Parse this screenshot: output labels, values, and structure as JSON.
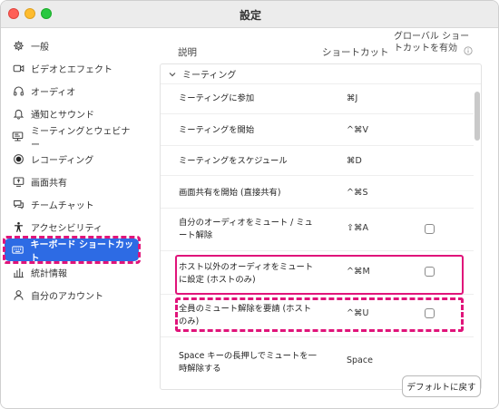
{
  "window": {
    "title": "設定"
  },
  "sidebar": {
    "items": [
      {
        "label": "一般",
        "icon": "gear-icon"
      },
      {
        "label": "ビデオとエフェクト",
        "icon": "video-icon"
      },
      {
        "label": "オーディオ",
        "icon": "headphones-icon"
      },
      {
        "label": "通知とサウンド",
        "icon": "bell-icon"
      },
      {
        "label": "ミーティングとウェビナー",
        "icon": "presentation-icon"
      },
      {
        "label": "レコーディング",
        "icon": "record-icon"
      },
      {
        "label": "画面共有",
        "icon": "screen-share-icon"
      },
      {
        "label": "チームチャット",
        "icon": "chat-icon"
      },
      {
        "label": "アクセシビリティ",
        "icon": "accessibility-icon"
      },
      {
        "label": "キーボード ショートカット",
        "icon": "keyboard-icon",
        "selected": true
      },
      {
        "label": "統計情報",
        "icon": "stats-icon"
      },
      {
        "label": "自分のアカウント",
        "icon": "account-icon"
      }
    ]
  },
  "table": {
    "headers": {
      "description": "説明",
      "shortcut": "ショートカット",
      "global": "グローバル ショートカットを有効"
    },
    "section": "ミーティング",
    "rows": [
      {
        "description": "ミーティングに参加",
        "shortcut": "⌘J",
        "has_checkbox": false
      },
      {
        "description": "ミーティングを開始",
        "shortcut": "^⌘V",
        "has_checkbox": false
      },
      {
        "description": "ミーティングをスケジュール",
        "shortcut": "⌘D",
        "has_checkbox": false
      },
      {
        "description": "画面共有を開始 (直接共有)",
        "shortcut": "^⌘S",
        "has_checkbox": false
      },
      {
        "description": "自分のオーディオをミュート / ミュート解除",
        "shortcut": "⇧⌘A",
        "has_checkbox": true
      },
      {
        "description": "ホスト以外のオーディオをミュートに設定 (ホストのみ)",
        "shortcut": "^⌘M",
        "has_checkbox": true
      },
      {
        "description": "全員のミュート解除を要請 (ホストのみ)",
        "shortcut": "^⌘U",
        "has_checkbox": true
      },
      {
        "description": "Space キーの長押しでミュートを一時解除する",
        "shortcut": "Space",
        "has_checkbox": false
      }
    ]
  },
  "footer": {
    "reset_label": "デフォルトに戻す"
  },
  "colors": {
    "accent": "#2d6be4",
    "highlight": "#e0147a"
  }
}
